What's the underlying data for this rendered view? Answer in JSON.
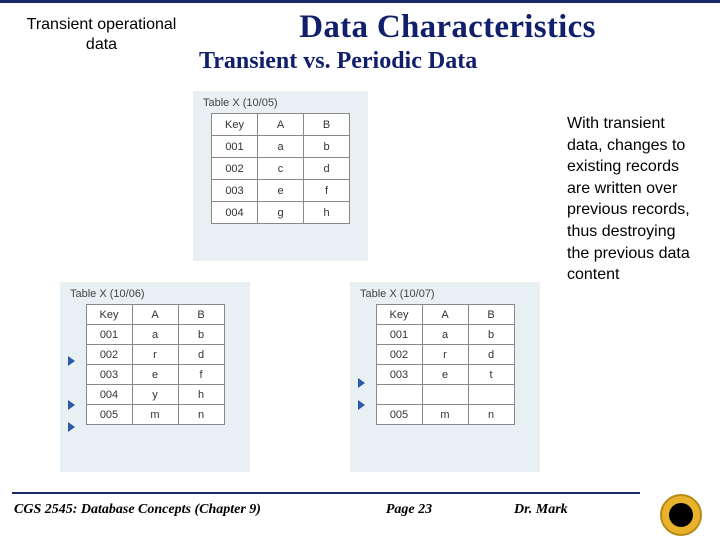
{
  "header": {
    "left_label": "Transient operational data",
    "title": "Data Characteristics",
    "subtitle": "Transient vs. Periodic Data"
  },
  "description": "With transient data, changes to existing records are written over previous records, thus destroying the previous data content",
  "tables": {
    "t1": {
      "caption": "Table X (10/05)",
      "columns": [
        "Key",
        "A",
        "B"
      ],
      "rows": [
        [
          "001",
          "a",
          "b"
        ],
        [
          "002",
          "c",
          "d"
        ],
        [
          "003",
          "e",
          "f"
        ],
        [
          "004",
          "g",
          "h"
        ]
      ]
    },
    "t2": {
      "caption": "Table X (10/06)",
      "columns": [
        "Key",
        "A",
        "B"
      ],
      "rows": [
        [
          "001",
          "a",
          "b"
        ],
        [
          "002",
          "r",
          "d"
        ],
        [
          "003",
          "e",
          "f"
        ],
        [
          "004",
          "y",
          "h"
        ],
        [
          "005",
          "m",
          "n"
        ]
      ],
      "markers": [
        1,
        3,
        4
      ]
    },
    "t3": {
      "caption": "Table X (10/07)",
      "columns": [
        "Key",
        "A",
        "B"
      ],
      "rows": [
        [
          "001",
          "a",
          "b"
        ],
        [
          "002",
          "r",
          "d"
        ],
        [
          "003",
          "e",
          "t"
        ],
        [
          "",
          "",
          ""
        ],
        [
          "005",
          "m",
          "n"
        ]
      ],
      "markers": [
        2,
        3
      ]
    }
  },
  "footer": {
    "course": "CGS 2545: Database Concepts  (Chapter 9)",
    "page": "Page 23",
    "author": "Dr. Mark"
  }
}
